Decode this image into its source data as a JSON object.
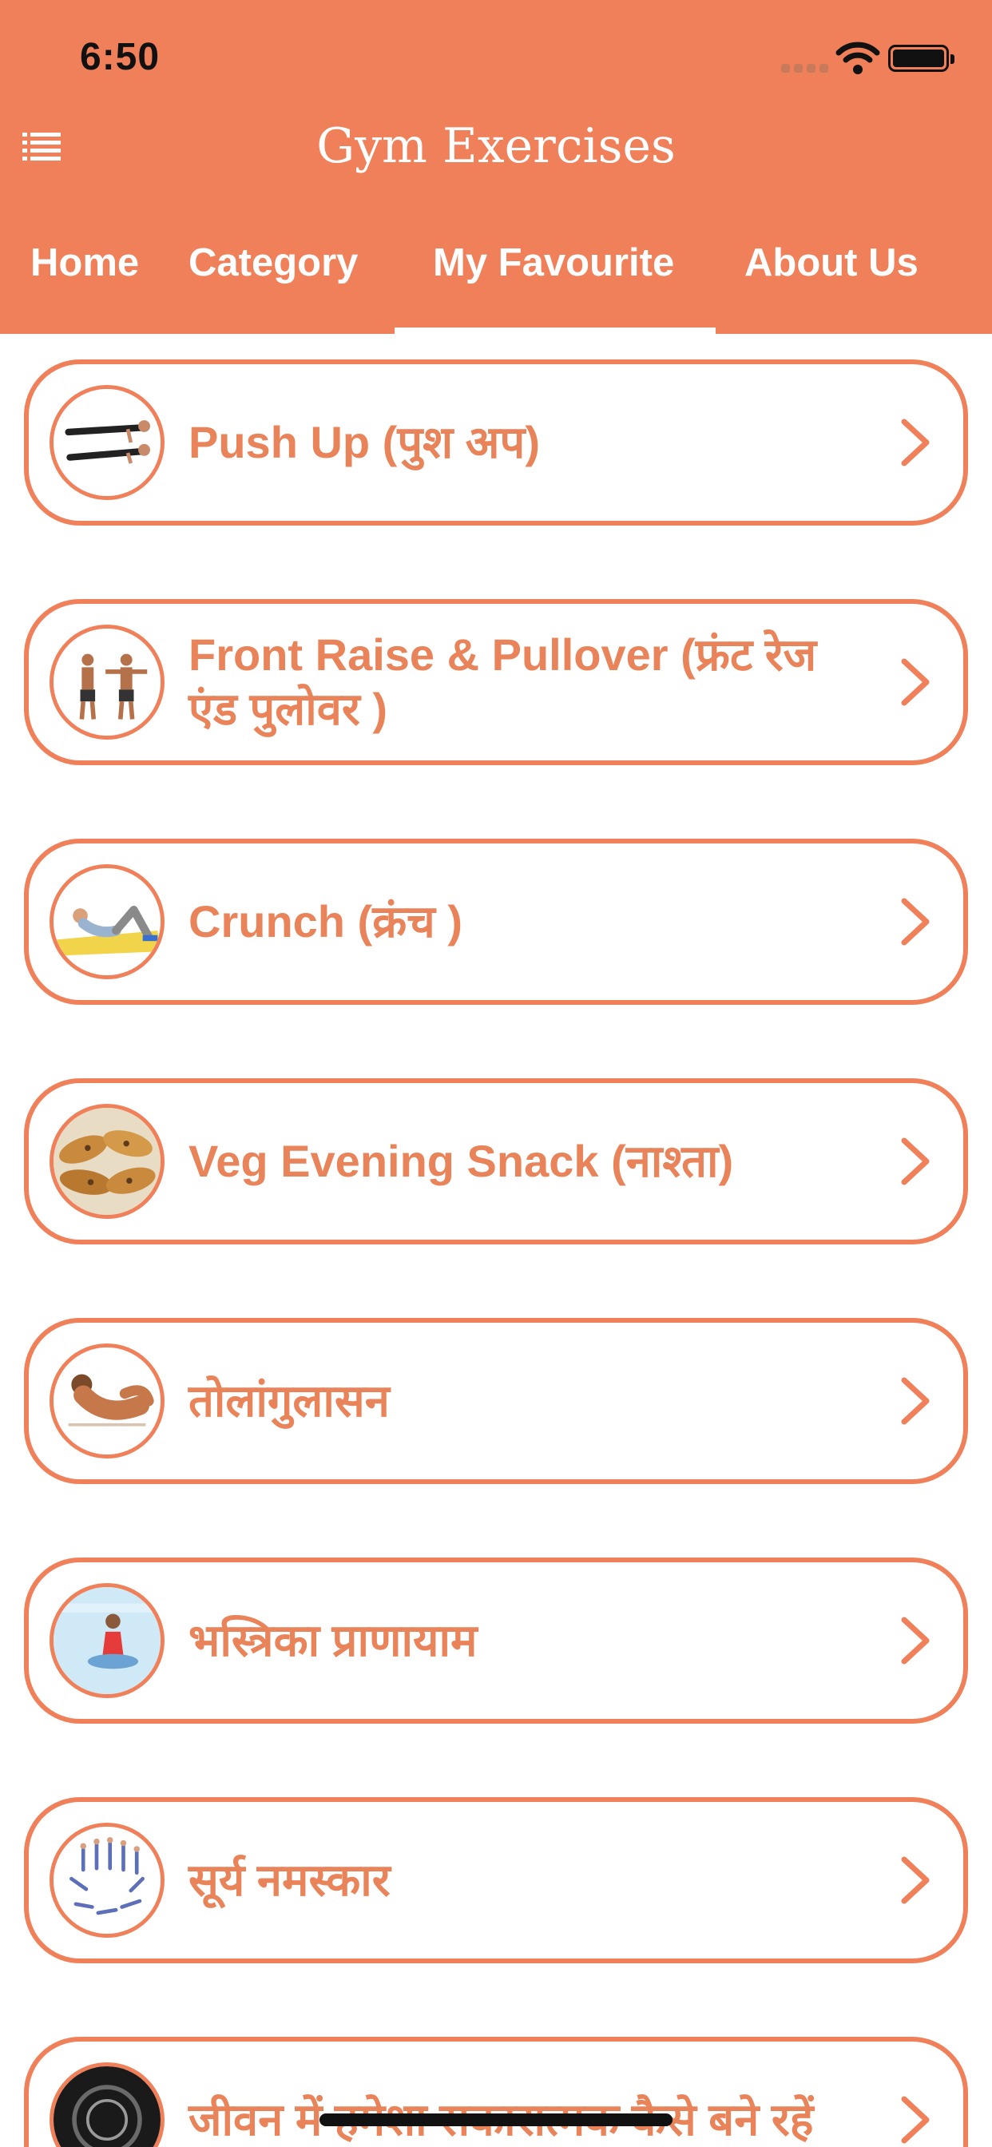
{
  "status_bar": {
    "time": "6:50"
  },
  "app": {
    "title": "Gym Exercises"
  },
  "tabs": [
    {
      "label": "Home"
    },
    {
      "label": "Category"
    },
    {
      "label": "My Favourite"
    },
    {
      "label": "About Us"
    }
  ],
  "active_tab": "My Favourite",
  "favourites": [
    {
      "label": "Push Up (पुश अप)",
      "icon": "push-up-thumbnail"
    },
    {
      "label": "Front Raise & Pullover (फ्रंट रेज एंड पुलोवर )",
      "icon": "front-raise-thumbnail"
    },
    {
      "label": "Crunch (क्रंच )",
      "icon": "crunch-thumbnail"
    },
    {
      "label": "Veg Evening Snack (नाश्ता)",
      "icon": "snack-thumbnail"
    },
    {
      "label": "तोलांगुलासन",
      "icon": "yoga-pose-thumbnail"
    },
    {
      "label": "भस्त्रिका प्राणायाम",
      "icon": "pranayama-thumbnail"
    },
    {
      "label": "सूर्य नमस्कार",
      "icon": "surya-namaskar-thumbnail"
    },
    {
      "label": "जीवन में हमेशा सकारात्मक कैसे बने रहें",
      "icon": "positivity-thumbnail"
    }
  ],
  "colors": {
    "accent": "#F0805A",
    "text_accent": "#E9845A",
    "background": "#FFFFFF"
  }
}
